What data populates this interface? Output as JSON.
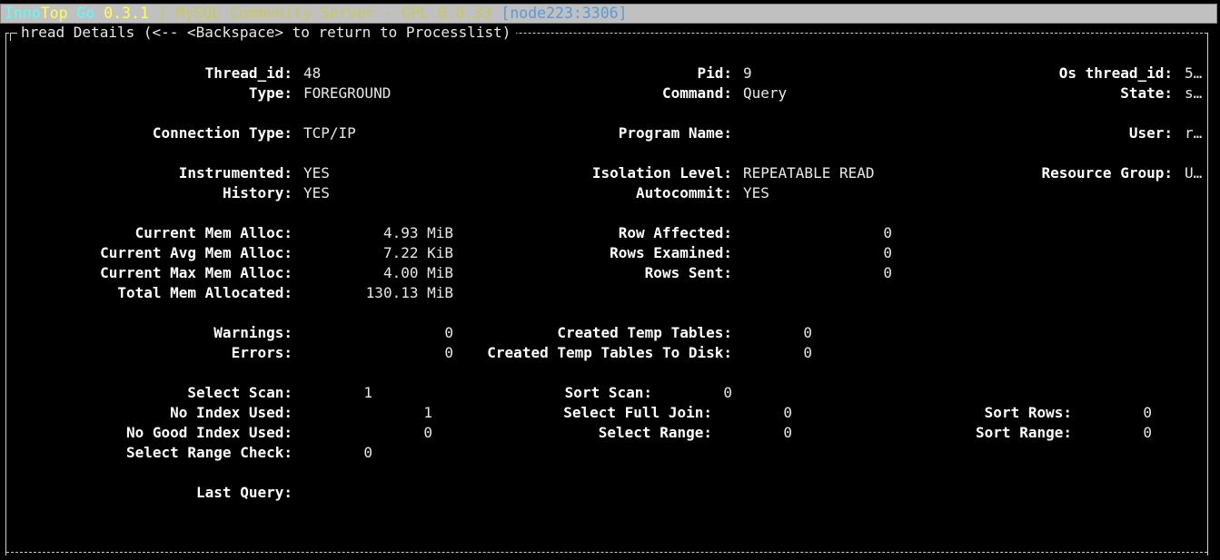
{
  "title_bar": {
    "inno": "Inno",
    "top": "Top",
    "go": " Go",
    "version": " 0.3.1",
    "separator": " | ",
    "server": "MySQL Community Server - GPL 8.0.33",
    "node": " [node223:3306]"
  },
  "panel": {
    "title": "hread Details (<-- <Backspace> to return to Processlist)"
  },
  "thread": {
    "thread_id_label": "Thread_id:",
    "thread_id": "48",
    "pid_label": "Pid:",
    "pid": "9",
    "os_thread_id_label": "Os thread_id:",
    "os_thread_id": "5…",
    "type_label": "Type:",
    "type": "FOREGROUND",
    "command_label": "Command:",
    "command": "Query",
    "state_label": "State:",
    "state": "s…"
  },
  "connection": {
    "connection_type_label": "Connection Type:",
    "connection_type": "TCP/IP",
    "program_name_label": "Program Name:",
    "program_name": "",
    "user_label": "User:",
    "user": "r…"
  },
  "instrumentation": {
    "instrumented_label": "Instrumented:",
    "instrumented": "YES",
    "isolation_label": "Isolation Level:",
    "isolation": "REPEATABLE READ",
    "resource_group_label": "Resource Group:",
    "resource_group": "U…",
    "history_label": "History:",
    "history": "YES",
    "autocommit_label": "Autocommit:",
    "autocommit": "YES"
  },
  "memory": {
    "cur_mem_label": "Current Mem Alloc:",
    "cur_mem": "4.93 MiB",
    "avg_mem_label": "Current Avg Mem Alloc:",
    "avg_mem": "7.22 KiB",
    "max_mem_label": "Current Max Mem Alloc:",
    "max_mem": "4.00 MiB",
    "total_mem_label": "Total Mem Allocated:",
    "total_mem": "130.13 MiB",
    "row_affected_label": "Row Affected:",
    "row_affected": "0",
    "rows_examined_label": "Rows Examined:",
    "rows_examined": "0",
    "rows_sent_label": "Rows Sent:",
    "rows_sent": "0"
  },
  "warnings": {
    "warnings_label": "Warnings:",
    "warnings": "0",
    "errors_label": "Errors:",
    "errors": "0",
    "tmp_tables_label": "Created Temp Tables:",
    "tmp_tables": "0",
    "tmp_disk_label": "Created Temp Tables To Disk:",
    "tmp_disk": "0"
  },
  "scans": {
    "select_scan_label": "Select Scan:",
    "select_scan": "1",
    "sort_scan_label": "Sort Scan:",
    "sort_scan": "0",
    "no_index_label": "No Index Used:",
    "no_index": "1",
    "full_join_label": "Select Full Join:",
    "full_join": "0",
    "sort_rows_label": "Sort Rows:",
    "sort_rows": "0",
    "no_good_index_label": "No Good Index Used:",
    "no_good_index": "0",
    "select_range_label": "Select Range:",
    "select_range": "0",
    "sort_range_label": "Sort Range:",
    "sort_range": "0",
    "range_check_label": "Select Range Check:",
    "range_check": "0"
  },
  "query": {
    "last_query_label": "Last Query:",
    "last_query": ""
  }
}
